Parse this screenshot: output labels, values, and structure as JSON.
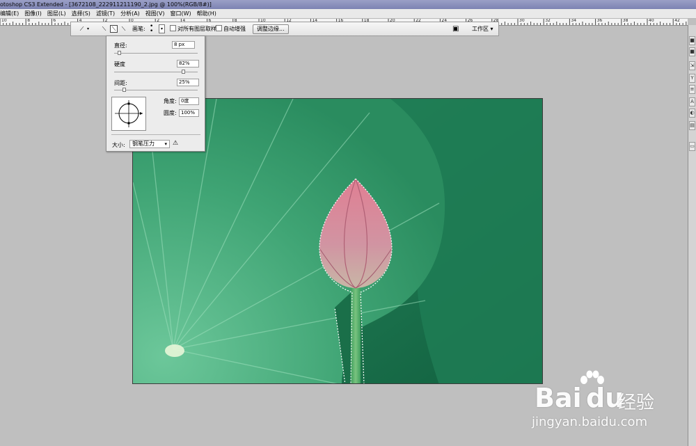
{
  "window": {
    "title": "otoshop CS3 Extended - [3672108_222911211190_2.jpg @ 100%(RGB/8#)]"
  },
  "menu": {
    "items": [
      {
        "label": "编辑(E)"
      },
      {
        "label": "图像(I)"
      },
      {
        "label": "图层(L)"
      },
      {
        "label": "选择(S)"
      },
      {
        "label": "滤镜(T)"
      },
      {
        "label": "分析(A)"
      },
      {
        "label": "视图(V)"
      },
      {
        "label": "窗口(W)"
      },
      {
        "label": "帮助(H)"
      }
    ]
  },
  "ruler": {
    "labels": [
      "10",
      "8",
      "6",
      "4",
      "2",
      "0",
      "2",
      "4",
      "6",
      "8",
      "10",
      "12",
      "14",
      "16",
      "18",
      "20",
      "22",
      "24",
      "26",
      "28",
      "30",
      "32",
      "34",
      "36",
      "38",
      "40",
      "42"
    ]
  },
  "options_bar": {
    "brush_label": "画笔:",
    "sample_all_layers_label": "对所有图层取样",
    "auto_enhance_label": "自动增强",
    "refine_edge_button": "调整边缘...",
    "workspace_label": "工作区"
  },
  "brush_panel": {
    "diameter_label": "直径:",
    "diameter_value": "8 px",
    "diameter_fraction": 0.04,
    "hardness_label": "硬度",
    "hardness_value": "82%",
    "hardness_fraction": 0.82,
    "spacing_label": "间距:",
    "spacing_value": "25%",
    "spacing_fraction": 0.1,
    "angle_label": "角度:",
    "angle_value": "0度",
    "roundness_label": "圆度:",
    "roundness_value": "100%",
    "size_label": "大小:",
    "size_value": "钢笔压力"
  },
  "watermark": {
    "brand_left": "Bai",
    "brand_right": "du",
    "product": "经验",
    "url": "jingyan.baidu.com"
  },
  "colors": {
    "selection": "#ffffff",
    "leaf_light": "#5fc18f",
    "leaf_dark": "#1d7a52",
    "bud_pink": "#d98a9b"
  }
}
